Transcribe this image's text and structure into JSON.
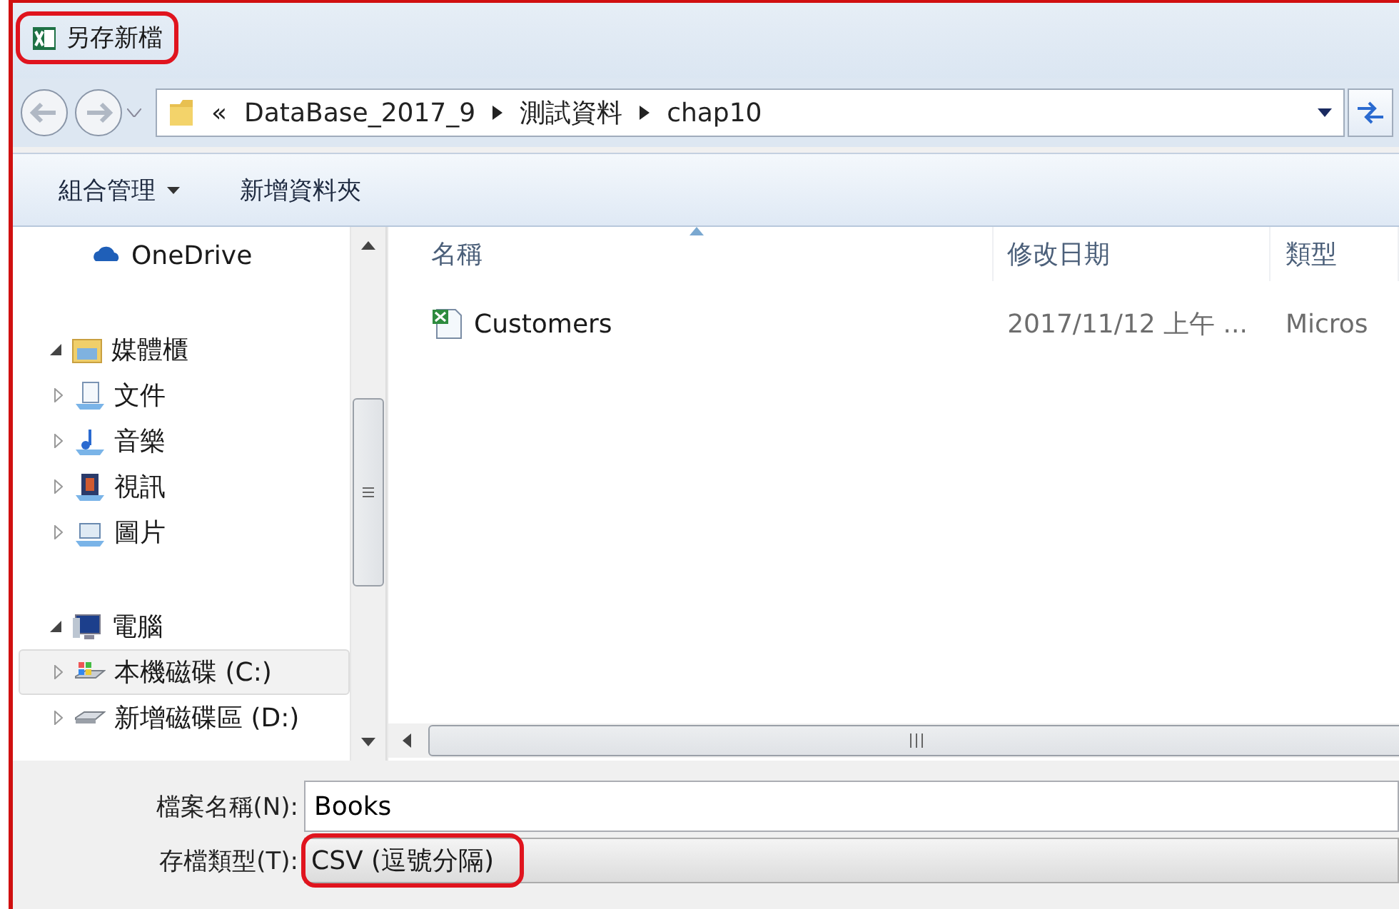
{
  "window": {
    "title": "另存新檔",
    "highlighted": true
  },
  "address": {
    "overflow": "«",
    "crumbs": [
      "DataBase_2017_9",
      "測試資料",
      "chap10"
    ]
  },
  "toolbar": [
    {
      "label": "組合管理",
      "dropdown": true
    },
    {
      "label": "新增資料夾",
      "dropdown": false
    }
  ],
  "sidebar": {
    "items": [
      {
        "label": "OneDrive",
        "selected": false
      },
      {
        "label": "媒體櫃",
        "expanded": true,
        "selected": false,
        "children": [
          {
            "label": "文件",
            "expanded": false,
            "selected": false
          },
          {
            "label": "音樂",
            "expanded": false,
            "selected": false
          },
          {
            "label": "視訊",
            "expanded": false,
            "selected": false
          },
          {
            "label": "圖片",
            "expanded": false,
            "selected": false
          }
        ]
      },
      {
        "label": "電腦",
        "expanded": true,
        "selected": false,
        "children": [
          {
            "label": "本機磁碟 (C:)",
            "expanded": false,
            "selected": true
          },
          {
            "label": "新增磁碟區 (D:)",
            "expanded": false,
            "selected": false
          }
        ]
      }
    ]
  },
  "table": {
    "columns": [
      {
        "label": "名稱",
        "sorted": true
      },
      {
        "label": "修改日期",
        "sorted": false
      },
      {
        "label": "類型",
        "sorted": false
      }
    ],
    "rows": [
      {
        "name": "Customers",
        "modified": "2017/11/12 上午 ...",
        "type": "Micros"
      }
    ]
  },
  "form": {
    "fields": [
      {
        "kind": "text",
        "label": "檔案名稱(N):",
        "value": "Books",
        "highlighted": false
      },
      {
        "kind": "dropdown",
        "label": "存檔類型(T):",
        "value": "CSV (逗號分隔)",
        "highlighted": true
      }
    ]
  }
}
